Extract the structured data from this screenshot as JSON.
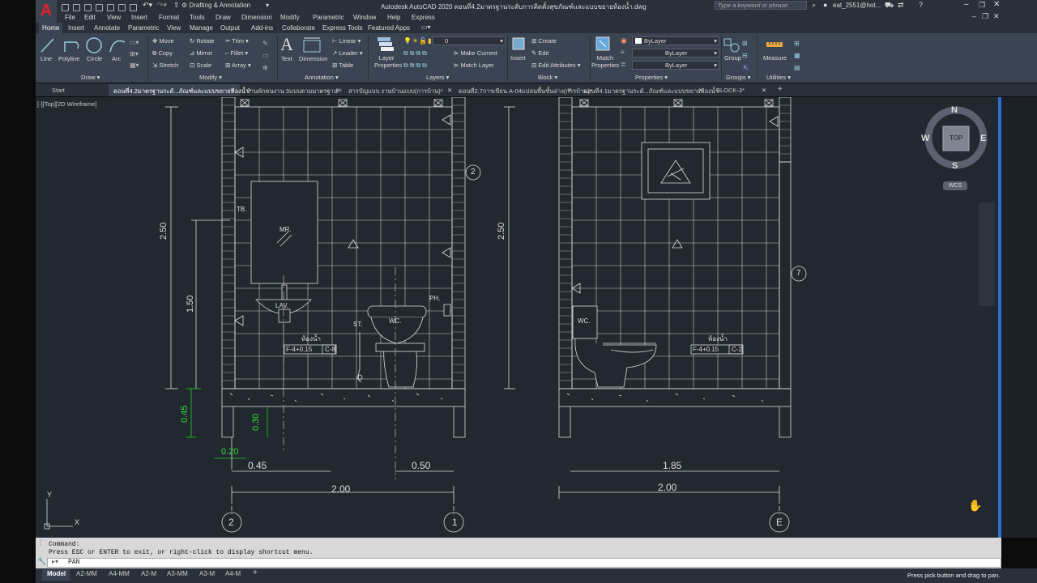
{
  "app": {
    "title": "Autodesk AutoCAD 2020   ดอนที่4.2มาตรฐานระดับการติดตั้งสุขภัณฑ์และแบบขยายห้องน้ำ.dwg",
    "workspace": "Drafting & Annotation",
    "search_placeholder": "Type a keyword or phrase",
    "user": "eat_2551@hot...",
    "logo": "A"
  },
  "menu": [
    "File",
    "Edit",
    "View",
    "Insert",
    "Format",
    "Tools",
    "Draw",
    "Dimension",
    "Modify",
    "Parametric",
    "Window",
    "Help",
    "Express"
  ],
  "ribbon_tabs": [
    "Home",
    "Insert",
    "Annotate",
    "Parametric",
    "View",
    "Manage",
    "Output",
    "Add-ins",
    "Collaborate",
    "Express Tools",
    "Featured Apps"
  ],
  "ribbon": {
    "draw": {
      "group": "Draw",
      "tools": [
        "Line",
        "Polyline",
        "Circle",
        "Arc"
      ]
    },
    "modify": {
      "group": "Modify",
      "tools": [
        "Move",
        "Rotate",
        "Trim",
        "Copy",
        "Mirror",
        "Fillet",
        "Stretch",
        "Scale",
        "Array"
      ]
    },
    "annotation": {
      "group": "Annotation",
      "tools": [
        "Text",
        "Dimension",
        "Linear",
        "Leader",
        "Table"
      ]
    },
    "layers": {
      "group": "Layers",
      "tool": "Layer Properties",
      "current": "0",
      "match": "Make Current",
      "match_layer": "Match Layer"
    },
    "block": {
      "group": "Block",
      "insert": "Insert",
      "create": "Create",
      "edit": "Edit",
      "edit_attr": "Edit Attributes"
    },
    "properties": {
      "group": "Properties",
      "match": "Match Properties",
      "bylayer": [
        "ByLayer",
        "ByLayer",
        "ByLayer"
      ]
    },
    "groups": {
      "group": "Groups",
      "tool": "Group"
    },
    "utilities": {
      "group": "Utilities",
      "tool": "Measure"
    }
  },
  "doc_tabs": [
    "Start",
    "ดอนที่4.2มาตรฐานระดั...ภัณฑ์และแบบขยายห้องน้ำ*",
    "บ้านพักคนงาน 3แบบตามมาตรฐาน *",
    "สารบัญแบบ งานบ้านแบบ(การบ้าน)*",
    "ดอนที่2.7การเขียน A-04แปลนพื้นชั้นล่าง(การบ้าน)*",
    "ดอนที่4.1มาตรฐานระดั...ภัณฑ์และแบบขยายห้องน้ำ",
    "BLOCK-3*"
  ],
  "viewport_label": "[-][Top][2D Wireframe]",
  "viewcube": {
    "top": "TOP",
    "n": "N",
    "s": "S",
    "e": "E",
    "w": "W",
    "wcs": "WCS"
  },
  "drawing": {
    "left": {
      "dims_v": [
        "2.50",
        "1.50",
        "0.45",
        "0.30"
      ],
      "dims_h": [
        "0.20",
        "0.45",
        "0.50",
        "2.00"
      ],
      "labels": [
        "TB.",
        "MR.",
        "LAV.",
        "ST.",
        "WC.",
        "PH.",
        "ห้องน้ำ",
        "F-4+0.15",
        "C-8"
      ],
      "grid": [
        "2",
        "1"
      ],
      "tag": "2"
    },
    "right": {
      "dims_v": [
        "2.50"
      ],
      "dims_h": [
        "1.85",
        "2.00"
      ],
      "labels": [
        "WC.",
        "ห้องน้ำ",
        "F-4+0.15",
        "C-2"
      ],
      "grid": [
        "E"
      ],
      "tag": "7"
    },
    "ucs": {
      "x": "X",
      "y": "Y"
    }
  },
  "command": {
    "line1": "Command:",
    "line2": "Press ESC or ENTER to exit, or right-click to display shortcut menu.",
    "input": "PAN"
  },
  "layout_tabs": [
    "Model",
    "A2-MM",
    "A4-MM",
    "A2-M",
    "A3-MM",
    "A3-M",
    "A4-M"
  ],
  "status": "Press pick button and drag to pan."
}
